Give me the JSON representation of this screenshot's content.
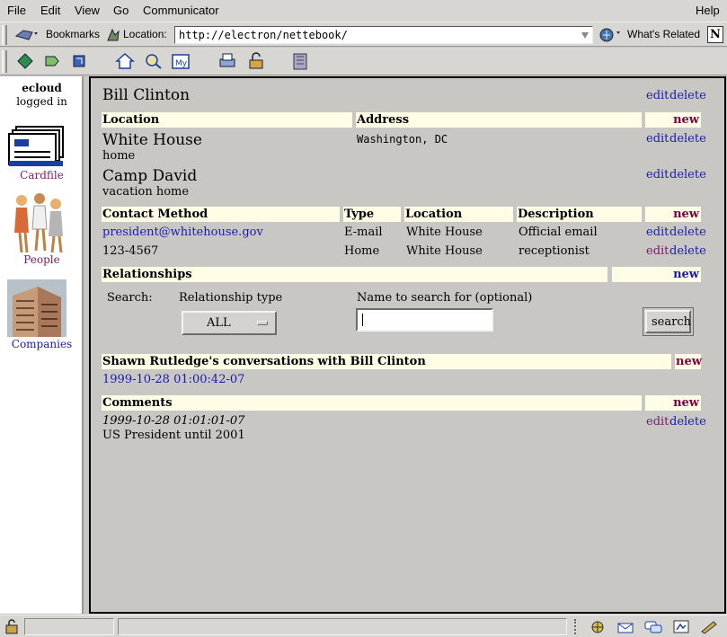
{
  "menu": {
    "file": "File",
    "edit": "Edit",
    "view": "View",
    "go": "Go",
    "communicator": "Communicator",
    "help": "Help"
  },
  "location_bar": {
    "bookmarks_label": "Bookmarks",
    "location_label": "Location:",
    "url": "http://electron/nettebook/",
    "whats_related": "What's Related",
    "logo_letter": "N"
  },
  "sidebar": {
    "user": "ecloud",
    "status": "logged in",
    "apps": [
      {
        "label": "Cardfile"
      },
      {
        "label": "People"
      },
      {
        "label": "Companies"
      }
    ]
  },
  "contact": {
    "name": "Bill Clinton",
    "edit": "edit",
    "delete": "delete",
    "locations_section": {
      "col_location": "Location",
      "col_address": "Address",
      "new": "new",
      "rows": [
        {
          "name": "White House",
          "note": "home",
          "address": "Washington, DC",
          "edit": "edit",
          "delete": "delete"
        },
        {
          "name": "Camp David",
          "note": "vacation home",
          "address": "",
          "edit": "edit",
          "delete": "delete"
        }
      ]
    },
    "contact_methods": {
      "col_method": "Contact Method",
      "col_type": "Type",
      "col_location": "Location",
      "col_description": "Description",
      "new": "new",
      "rows": [
        {
          "method": "president@whitehouse.gov",
          "type": "E-mail",
          "location": "White House",
          "description": "Official email",
          "edit": "edit",
          "delete": "delete"
        },
        {
          "method": "123-4567",
          "type": "Home",
          "location": "White House",
          "description": "receptionist",
          "edit": "edit",
          "delete": "delete"
        }
      ]
    },
    "relationships": {
      "title": "Relationships",
      "new": "new",
      "search_label": "Search:",
      "type_label": "Relationship type",
      "type_value": "ALL",
      "name_label": "Name to search for (optional)",
      "name_value": "",
      "search_button": "search"
    },
    "conversations": {
      "title": "Shawn Rutledge's conversations with Bill Clinton",
      "new": "new",
      "items": [
        "1999-10-28 01:00:42-07"
      ]
    },
    "comments": {
      "title": "Comments",
      "new": "new",
      "items": [
        {
          "timestamp": "1999-10-28 01:01:01-07",
          "text": "US President until 2001",
          "edit": "edit",
          "delete": "delete"
        }
      ]
    }
  },
  "colors": {
    "header_bg": "#fffde6",
    "link": "#1a1aaa",
    "visited": "#7a1a6a",
    "new_link": "#800040"
  }
}
